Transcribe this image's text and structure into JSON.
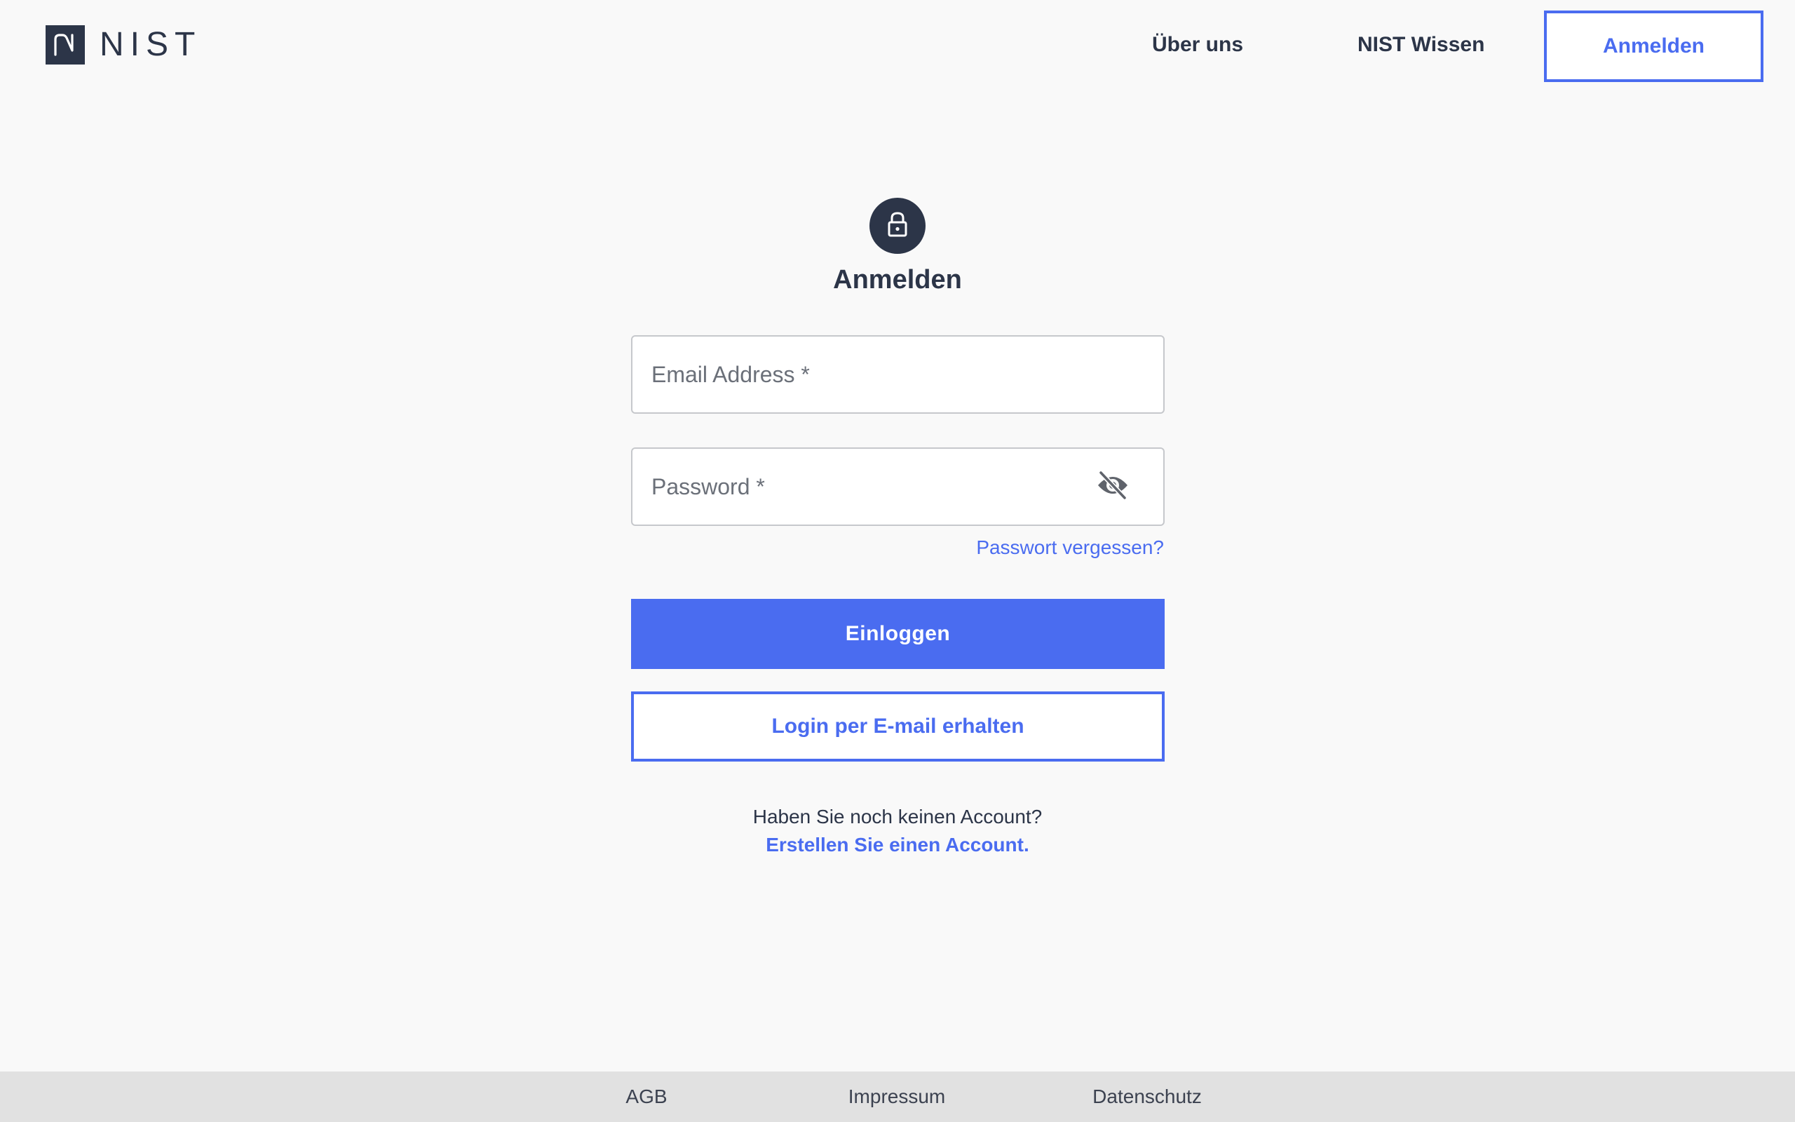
{
  "header": {
    "logo_text": "NIST",
    "nav": {
      "about": "Über uns",
      "wissen": "NIST Wissen",
      "login": "Anmelden"
    }
  },
  "login": {
    "title": "Anmelden",
    "email_placeholder": "Email Address *",
    "email_value": "",
    "password_placeholder": "Password *",
    "password_value": "",
    "forgot_password": "Passwort vergessen?",
    "submit_label": "Einloggen",
    "email_login_label": "Login per E-mail erhalten",
    "no_account_text": "Haben Sie noch keinen Account?",
    "create_account_link": "Erstellen Sie einen Account."
  },
  "footer": {
    "links": [
      "AGB",
      "Impressum",
      "Datenschutz"
    ]
  },
  "icons": {
    "logo": "nist-logo-icon",
    "lock": "lock-icon",
    "visibility_toggle": "eye-off-icon"
  },
  "colors": {
    "accent": "#4a6cf0",
    "dark": "#2c3548",
    "background": "#f9f9f9",
    "footer_bg": "#e1e1e1"
  }
}
